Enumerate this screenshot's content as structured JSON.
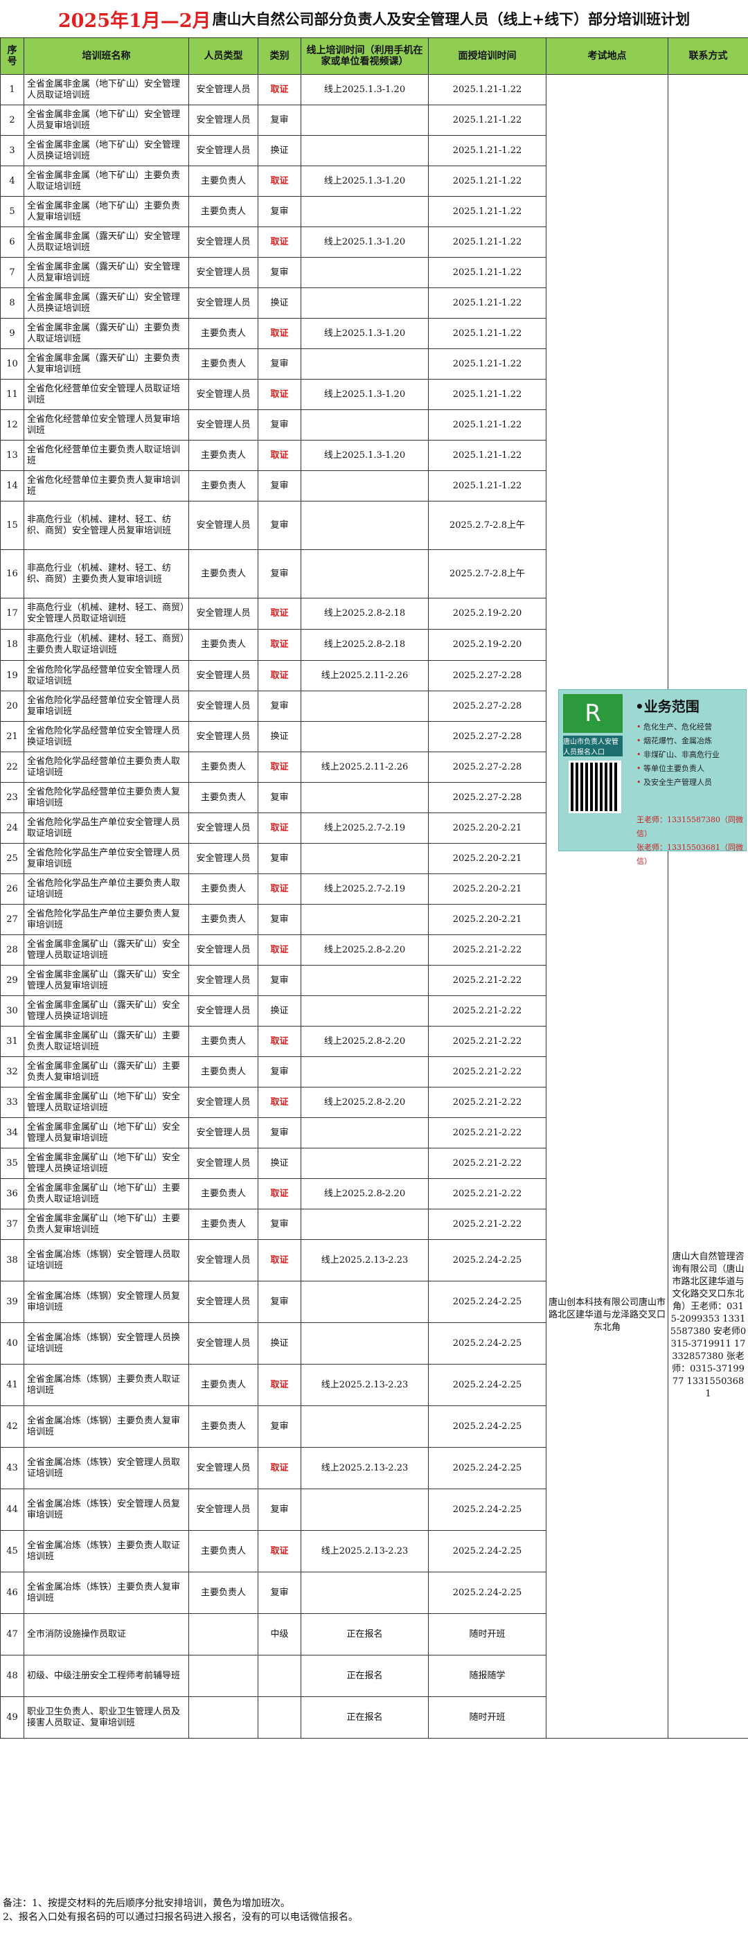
{
  "title": {
    "date": "2025年1月—2月",
    "rest": "唐山大自然公司部分负责人及安全管理人员（线上+线下）部分培训班计划"
  },
  "headers": [
    "序号",
    "培训班名称",
    "人员类型",
    "类别",
    "线上培训时间（利用手机在家或单位看视频课）",
    "面授培训时间",
    "考试地点",
    "联系方式"
  ],
  "rows": [
    [
      "1",
      "全省金属非金属（地下矿山）安全管理人员取证培训班",
      "安全管理人员",
      "取证",
      "线上2025.1.3-1.20",
      "2025.1.21-1.22"
    ],
    [
      "2",
      "全省金属非金属（地下矿山）安全管理人员复审培训班",
      "安全管理人员",
      "复审",
      "",
      "2025.1.21-1.22"
    ],
    [
      "3",
      "全省金属非金属（地下矿山）安全管理人员换证培训班",
      "安全管理人员",
      "换证",
      "",
      "2025.1.21-1.22"
    ],
    [
      "4",
      "全省金属非金属（地下矿山）主要负责人取证培训班",
      "主要负责人",
      "取证",
      "线上2025.1.3-1.20",
      "2025.1.21-1.22"
    ],
    [
      "5",
      "全省金属非金属（地下矿山）主要负责人复审培训班",
      "主要负责人",
      "复审",
      "",
      "2025.1.21-1.22"
    ],
    [
      "6",
      "全省金属非金属（露天矿山）安全管理人员取证培训班",
      "安全管理人员",
      "取证",
      "线上2025.1.3-1.20",
      "2025.1.21-1.22"
    ],
    [
      "7",
      "全省金属非金属（露天矿山）安全管理人员复审培训班",
      "安全管理人员",
      "复审",
      "",
      "2025.1.21-1.22"
    ],
    [
      "8",
      "全省金属非金属（露天矿山）安全管理人员换证培训班",
      "安全管理人员",
      "换证",
      "",
      "2025.1.21-1.22"
    ],
    [
      "9",
      "全省金属非金属（露天矿山）主要负责人取证培训班",
      "主要负责人",
      "取证",
      "线上2025.1.3-1.20",
      "2025.1.21-1.22"
    ],
    [
      "10",
      "全省金属非金属（露天矿山）主要负责人复审培训班",
      "主要负责人",
      "复审",
      "",
      "2025.1.21-1.22"
    ],
    [
      "11",
      "全省危化经营单位安全管理人员取证培训班",
      "安全管理人员",
      "取证",
      "线上2025.1.3-1.20",
      "2025.1.21-1.22"
    ],
    [
      "12",
      "全省危化经营单位安全管理人员复审培训班",
      "安全管理人员",
      "复审",
      "",
      "2025.1.21-1.22"
    ],
    [
      "13",
      "全省危化经营单位主要负责人取证培训班",
      "主要负责人",
      "取证",
      "线上2025.1.3-1.20",
      "2025.1.21-1.22"
    ],
    [
      "14",
      "全省危化经营单位主要负责人复审培训班",
      "主要负责人",
      "复审",
      "",
      "2025.1.21-1.22"
    ],
    [
      "15",
      "非高危行业（机械、建材、轻工、纺织、商贸）安全管理人员复审培训班",
      "安全管理人员",
      "复审",
      "",
      "2025.2.7-2.8上午"
    ],
    [
      "16",
      "非高危行业（机械、建材、轻工、纺织、商贸）主要负责人复审培训班",
      "主要负责人",
      "复审",
      "",
      "2025.2.7-2.8上午"
    ],
    [
      "17",
      "非高危行业（机械、建材、轻工、商贸）安全管理人员取证培训班",
      "安全管理人员",
      "取证",
      "线上2025.2.8-2.18",
      "2025.2.19-2.20"
    ],
    [
      "18",
      "非高危行业（机械、建材、轻工、商贸）主要负责人取证培训班",
      "主要负责人",
      "取证",
      "线上2025.2.8-2.18",
      "2025.2.19-2.20"
    ],
    [
      "19",
      "全省危险化学品经营单位安全管理人员取证培训班",
      "安全管理人员",
      "取证",
      "线上2025.2.11-2.26",
      "2025.2.27-2.28"
    ],
    [
      "20",
      "全省危险化学品经营单位安全管理人员复审培训班",
      "安全管理人员",
      "复审",
      "",
      "2025.2.27-2.28"
    ],
    [
      "21",
      "全省危险化学品经营单位安全管理人员换证培训班",
      "安全管理人员",
      "换证",
      "",
      "2025.2.27-2.28"
    ],
    [
      "22",
      "全省危险化学品经营单位主要负责人取证培训班",
      "主要负责人",
      "取证",
      "线上2025.2.11-2.26",
      "2025.2.27-2.28"
    ],
    [
      "23",
      "全省危险化学品经营单位主要负责人复审培训班",
      "主要负责人",
      "复审",
      "",
      "2025.2.27-2.28"
    ],
    [
      "24",
      "全省危险化学品生产单位安全管理人员取证培训班",
      "安全管理人员",
      "取证",
      "线上2025.2.7-2.19",
      "2025.2.20-2.21"
    ],
    [
      "25",
      "全省危险化学品生产单位安全管理人员复审培训班",
      "安全管理人员",
      "复审",
      "",
      "2025.2.20-2.21"
    ],
    [
      "26",
      "全省危险化学品生产单位主要负责人取证培训班",
      "主要负责人",
      "取证",
      "线上2025.2.7-2.19",
      "2025.2.20-2.21"
    ],
    [
      "27",
      "全省危险化学品生产单位主要负责人复审培训班",
      "主要负责人",
      "复审",
      "",
      "2025.2.20-2.21"
    ],
    [
      "28",
      "全省金属非金属矿山（露天矿山）安全管理人员取证培训班",
      "安全管理人员",
      "取证",
      "线上2025.2.8-2.20",
      "2025.2.21-2.22"
    ],
    [
      "29",
      "全省金属非金属矿山（露天矿山）安全管理人员复审培训班",
      "安全管理人员",
      "复审",
      "",
      "2025.2.21-2.22"
    ],
    [
      "30",
      "全省金属非金属矿山（露天矿山）安全管理人员换证培训班",
      "安全管理人员",
      "换证",
      "",
      "2025.2.21-2.22"
    ],
    [
      "31",
      "全省金属非金属矿山（露天矿山）主要负责人取证培训班",
      "主要负责人",
      "取证",
      "线上2025.2.8-2.20",
      "2025.2.21-2.22"
    ],
    [
      "32",
      "全省金属非金属矿山（露天矿山）主要负责人复审培训班",
      "主要负责人",
      "复审",
      "",
      "2025.2.21-2.22"
    ],
    [
      "33",
      "全省金属非金属矿山（地下矿山）安全管理人员取证培训班",
      "安全管理人员",
      "取证",
      "线上2025.2.8-2.20",
      "2025.2.21-2.22"
    ],
    [
      "34",
      "全省金属非金属矿山（地下矿山）安全管理人员复审培训班",
      "安全管理人员",
      "复审",
      "",
      "2025.2.21-2.22"
    ],
    [
      "35",
      "全省金属非金属矿山（地下矿山）安全管理人员换证培训班",
      "安全管理人员",
      "换证",
      "",
      "2025.2.21-2.22"
    ],
    [
      "36",
      "全省金属非金属矿山（地下矿山）主要负责人取证培训班",
      "主要负责人",
      "取证",
      "线上2025.2.8-2.20",
      "2025.2.21-2.22"
    ],
    [
      "37",
      "全省金属非金属矿山（地下矿山）主要负责人复审培训班",
      "主要负责人",
      "复审",
      "",
      "2025.2.21-2.22"
    ],
    [
      "38",
      "全省金属冶炼（炼钢）安全管理人员取证培训班",
      "安全管理人员",
      "取证",
      "线上2025.2.13-2.23",
      "2025.2.24-2.25"
    ],
    [
      "39",
      "全省金属冶炼（炼钢）安全管理人员复审培训班",
      "安全管理人员",
      "复审",
      "",
      "2025.2.24-2.25"
    ],
    [
      "40",
      "全省金属冶炼（炼钢）安全管理人员换证培训班",
      "安全管理人员",
      "换证",
      "",
      "2025.2.24-2.25"
    ],
    [
      "41",
      "全省金属冶炼（炼钢）主要负责人取证培训班",
      "主要负责人",
      "取证",
      "线上2025.2.13-2.23",
      "2025.2.24-2.25"
    ],
    [
      "42",
      "全省金属冶炼（炼钢）主要负责人复审培训班",
      "主要负责人",
      "复审",
      "",
      "2025.2.24-2.25"
    ],
    [
      "43",
      "全省金属冶炼（炼铁）安全管理人员取证培训班",
      "安全管理人员",
      "取证",
      "线上2025.2.13-2.23",
      "2025.2.24-2.25"
    ],
    [
      "44",
      "全省金属冶炼（炼铁）安全管理人员复审培训班",
      "安全管理人员",
      "复审",
      "",
      "2025.2.24-2.25"
    ],
    [
      "45",
      "全省金属冶炼（炼铁）主要负责人取证培训班",
      "主要负责人",
      "取证",
      "线上2025.2.13-2.23",
      "2025.2.24-2.25"
    ],
    [
      "46",
      "全省金属冶炼（炼铁）主要负责人复审培训班",
      "主要负责人",
      "复审",
      "",
      "2025.2.24-2.25"
    ],
    [
      "47",
      "全市消防设施操作员取证",
      "",
      "中级",
      "正在报名",
      "随时开班"
    ],
    [
      "48",
      "初级、中级注册安全工程师考前辅导班",
      "",
      "",
      "正在报名",
      "随报随学"
    ],
    [
      "49",
      "职业卫生负责人、职业卫生管理人员及接害人员取证、复审培训班",
      "",
      "",
      "正在报名",
      "随时开班"
    ]
  ],
  "exam_location": "唐山创本科技有限公司唐山市路北区建华道与龙泽路交叉口东北角",
  "contact": "唐山大自然管理咨询有限公司（唐山市路北区建华道与文化路交叉口东北角）王老师：0315-2099353 13315587380 安老师0315-3719911 17332857380 张老师：0315-3719977 13315503681",
  "ad": {
    "heading": "•业务范围",
    "side_label": "唐山市负责人安管人员报名入口",
    "items": [
      "危化生产、危化经营",
      "烟花爆竹、金属冶炼",
      "非煤矿山、非高危行业",
      "等单位主要负责人",
      "及安全生产管理人员"
    ],
    "contacts": [
      "王老师：13315587380（同微信）",
      "张老师：13315503681（同微信）"
    ]
  },
  "notes": [
    "备注：1、按提交材料的先后顺序分批安排培训，黄色为增加班次。",
    "2、报名入口处有报名码的可以通过扫报名码进入报名，没有的可以电话微信报名。"
  ]
}
